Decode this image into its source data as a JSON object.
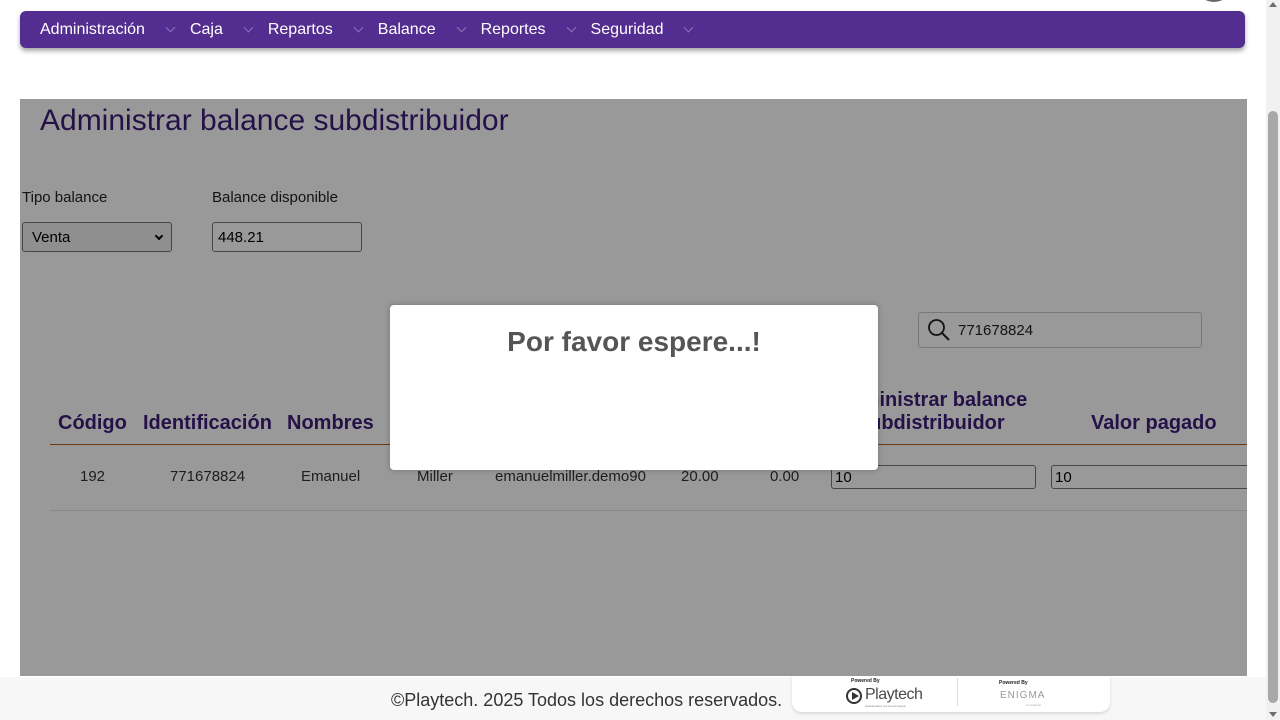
{
  "nav": {
    "items": [
      {
        "label": "Administración"
      },
      {
        "label": "Caja"
      },
      {
        "label": "Repartos"
      },
      {
        "label": "Balance"
      },
      {
        "label": "Reportes"
      },
      {
        "label": "Seguridad"
      }
    ]
  },
  "page": {
    "title": "Administrar balance subdistribuidor"
  },
  "filters": {
    "tipo_label": "Tipo balance",
    "tipo_value": "Venta",
    "balance_label": "Balance disponible",
    "balance_value": "448.21"
  },
  "search": {
    "value": "771678824",
    "icon": "search-icon"
  },
  "table": {
    "headers": {
      "codigo": "Código",
      "identificacion": "Identificación",
      "nombres": "Nombres",
      "administrar_line1": "Administrar balance",
      "administrar_line2": "subdistribuidor",
      "valor_pagado": "Valor pagado"
    },
    "rows": [
      {
        "codigo": "192",
        "identificacion": "771678824",
        "nombres": "Emanuel",
        "apellidos": "Miller",
        "usuario": "emanuelmiller.demo90",
        "valor1": "20.00",
        "valor2": "0.00",
        "administrar": "10",
        "valor_pagado": "10"
      }
    ]
  },
  "modal": {
    "text": "Por favor espere...!"
  },
  "footer": {
    "copyright": "©Playtech. 2025 Todos los derechos reservados.",
    "powered_by_1": "Powered By",
    "playtech_word": "Playtech",
    "playtech_tag": "Apasionados por la tecnología",
    "powered_by_2": "Powered By",
    "enigma_word": "ENIGMA",
    "enigma_tag": "Crowdsport"
  },
  "colors": {
    "nav_bg": "#532d8f",
    "title": "#3d1d78",
    "header_border": "#b5651d"
  }
}
